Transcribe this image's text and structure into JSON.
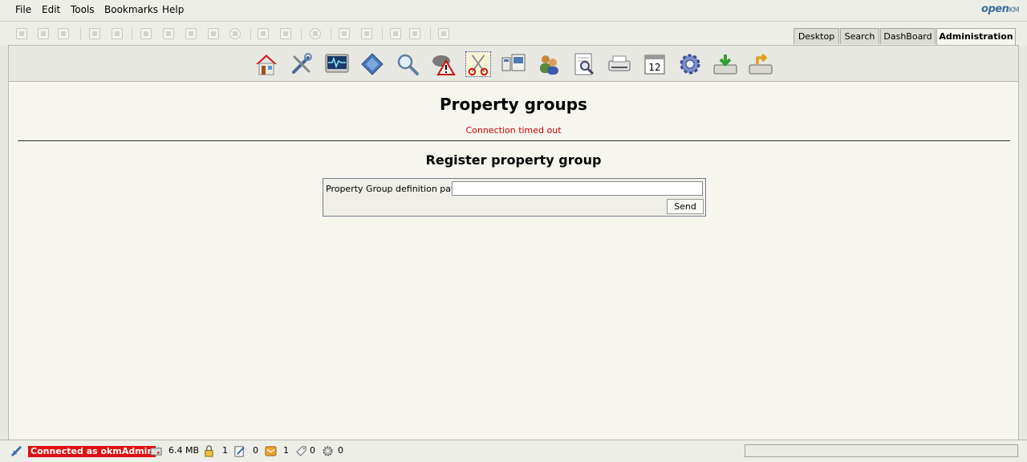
{
  "menu": {
    "items": [
      "File",
      "Edit",
      "Tools",
      "Bookmarks",
      "Help"
    ]
  },
  "logo": {
    "text": "openKM",
    "main": "open",
    "suffix": "KM"
  },
  "toolbar": {
    "buttons": [
      "create-folder-icon",
      "add-document-icon",
      "edit-document-icon",
      "lock-icon",
      "unlock-icon",
      "new-document-icon",
      "image-document-icon",
      "blank-document-icon",
      "document-icon",
      "delete-icon",
      "mail-icon",
      "mail-forward-icon",
      "settings-icon",
      "move-icon",
      "copy-icon",
      "refresh-icon",
      "home-icon",
      "print-icon"
    ]
  },
  "tabs": [
    {
      "label": "Desktop",
      "active": false
    },
    {
      "label": "Search",
      "active": false
    },
    {
      "label": "DashBoard",
      "active": false
    },
    {
      "label": "Administration",
      "active": true
    }
  ],
  "admin_icons": [
    "home-icon",
    "tools-icon",
    "monitor-icon",
    "workflow-icon",
    "search-icon",
    "alert-icon",
    "scissors-icon",
    "users-icon",
    "user-groups-icon",
    "document-search-icon",
    "scanner-icon",
    "calendar-icon",
    "gear-icon",
    "import-icon",
    "export-icon"
  ],
  "calendar": {
    "day": "12"
  },
  "page": {
    "title": "Property groups",
    "error": "Connection timed out",
    "subtitle": "Register property group"
  },
  "form": {
    "label": "Property Group definition path",
    "value": "",
    "placeholder": "",
    "send_label": "Send"
  },
  "status": {
    "connected_label": "Connected as okmAdmin",
    "memory": "6.4 MB",
    "locked_count": "1",
    "checkout_count": "0",
    "mail_count": "1",
    "subscription_count": "0",
    "tasks_count": "0"
  },
  "colors": {
    "error": "#d00000",
    "connected_bg": "#e01010",
    "logo": "#3a6f9c",
    "content_bg": "#f6f6ef"
  }
}
